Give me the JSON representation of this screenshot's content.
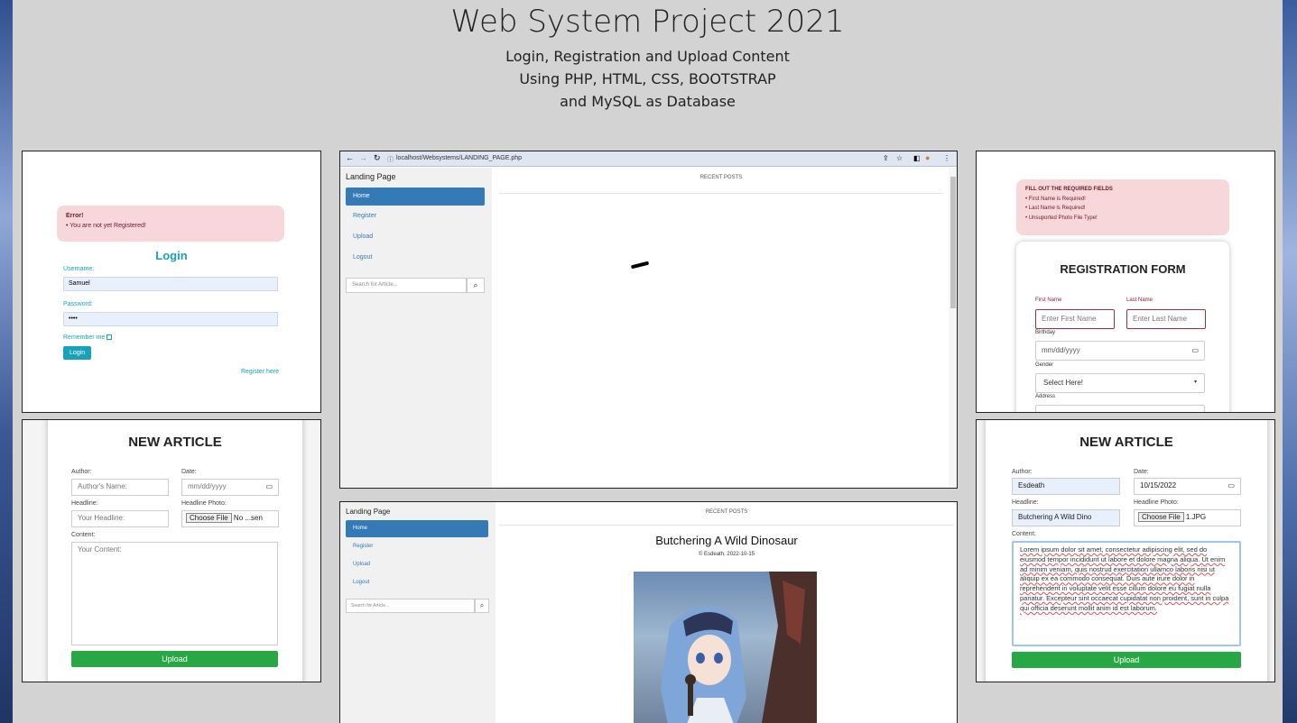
{
  "hero": {
    "title": "Web System Project 2021",
    "line1": "Login, Registration and Upload Content",
    "line2": "Using PHP, HTML, CSS, BOOTSTRAP",
    "line3": "and MySQL as Database"
  },
  "login": {
    "error_title": "Error!",
    "error_msg": "• You are not yet Registered!",
    "title": "Login",
    "username_label": "Username:",
    "username_value": "Samuel",
    "password_label": "Password:",
    "password_value": "••••",
    "remember_label": "Remember me",
    "login_button": "Login",
    "register_link": "Register here"
  },
  "article_empty": {
    "title": "NEW ARTICLE",
    "author_label": "Author:",
    "author_placeholder": "Author's Name:",
    "date_label": "Date:",
    "date_placeholder": "mm/dd/yyyy",
    "headline_label": "Headline:",
    "headline_placeholder": "Your Headline:",
    "photo_label": "Headline Photo:",
    "choose_file": "Choose File",
    "no_file": "No ...sen",
    "content_label": "Content:",
    "content_placeholder": "Your Content:",
    "upload_button": "Upload"
  },
  "browser": {
    "url": "localhost/Websystems/LANDING_PAGE.php",
    "brand": "Landing Page",
    "nav": [
      "Home",
      "Register",
      "Upload",
      "Logout"
    ],
    "search_placeholder": "Search for Article...",
    "section_title": "RECENT POSTS"
  },
  "landing2": {
    "brand": "Landing Page",
    "nav": [
      "Home",
      "Register",
      "Upload",
      "Logout"
    ],
    "search_placeholder": "Search for Article...",
    "section_title": "RECENT POSTS",
    "post_title": "Butchering A Wild Dinosaur",
    "post_meta": "Esdeath, 2022-10-15"
  },
  "registration": {
    "alert_title": "FILL OUT THE REQUIRED FIELDS",
    "alert_items": [
      "• First Name is Required!",
      "• Last Name is Required!",
      "• Unsuported Photo File Type!"
    ],
    "title": "REGISTRATION FORM",
    "first_label": "First Name",
    "first_placeholder": "Enter First Name",
    "last_label": "Last Name",
    "last_placeholder": "Enter Last Name",
    "birthday_label": "Birthday",
    "birthday_placeholder": "mm/dd/yyyy",
    "gender_label": "Gender",
    "gender_value": "Select Here!",
    "address_label": "Address"
  },
  "article_filled": {
    "title": "NEW ARTICLE",
    "author_label": "Author:",
    "author_value": "Esdeath",
    "date_label": "Date:",
    "date_value": "10/15/2022",
    "headline_label": "Headline:",
    "headline_value": "Butchering A Wild Dino",
    "photo_label": "Headline Photo:",
    "choose_file": "Choose File",
    "file_name": "1.JPG",
    "content_label": "Content:",
    "content_value": "Lorem ipsum dolor sit amet, consectetur adipiscing elit, sed do eiusmod tempor incididunt ut labore et dolore magna aliqua. Ut enim ad minim veniam, quis nostrud exercitation ullamco laboris nisi ut aliquip ex ea commodo consequat. Duis aute irure dolor in reprehenderit in voluptate velit esse cillum dolore eu fugiat nulla pariatur. Excepteur sint occaecat cupidatat non proident, sunt in culpa qui officia deserunt mollit anim id est laborum.",
    "upload_button": "Upload"
  }
}
